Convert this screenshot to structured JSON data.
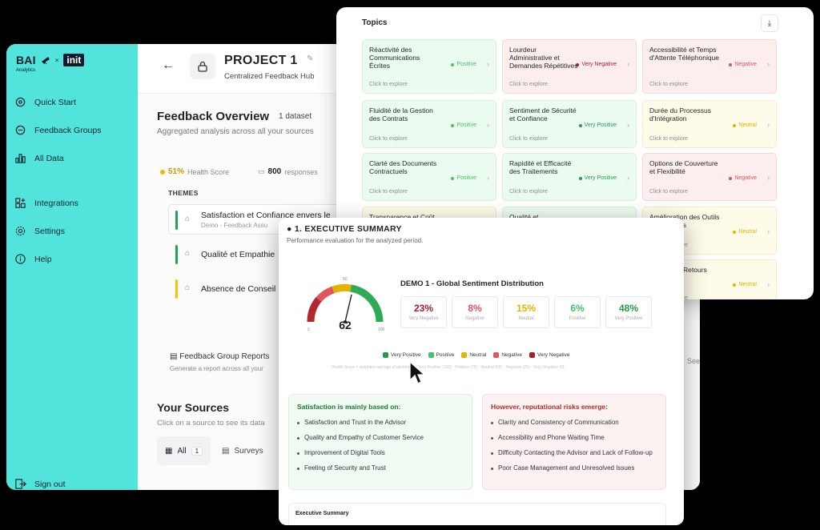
{
  "sidebar": {
    "brand": "BAI",
    "brand_sub": "Analytics",
    "brand_x": "×",
    "partner": "init",
    "items": [
      {
        "label": "Quick Start",
        "icon": "grid-icon"
      },
      {
        "label": "Feedback Groups",
        "icon": "layers-icon"
      },
      {
        "label": "All Data",
        "icon": "bar-chart-icon"
      },
      {
        "label": "Integrations",
        "icon": "integrations-icon"
      },
      {
        "label": "Settings",
        "icon": "gear-icon"
      },
      {
        "label": "Help",
        "icon": "info-icon"
      }
    ],
    "sign_out": "Sign out"
  },
  "header": {
    "project_title": "PROJECT 1",
    "project_subtitle": "Centralized Feedback Hub"
  },
  "overview": {
    "title": "Feedback Overview",
    "dataset_count": "1 dataset",
    "subtitle": "Aggregated analysis across all your sources",
    "health_value": "51%",
    "health_label": "Health Score",
    "responses_value": "800",
    "responses_label": "responses",
    "themes_label": "THEMES",
    "themes": [
      {
        "title": "Satisfaction et Confiance envers le",
        "sub": "Demo - Feedback Assu",
        "color": "#1fa84f"
      },
      {
        "title": "Qualité et Empathie",
        "sub": "",
        "color": "#1fa84f"
      },
      {
        "title": "Absence de Conseil",
        "sub": "",
        "color": "#f2c300"
      }
    ],
    "report_title": "Feedback Group Reports",
    "report_sub": "Generate a report across all your",
    "see_more": "See"
  },
  "sources": {
    "title": "Your Sources",
    "subtitle": "Click on a source to see its data",
    "tab_all": "All",
    "tab_all_count": "1",
    "tab_surveys": "Surveys"
  },
  "topics": {
    "title": "Topics",
    "explore": "Click to explore",
    "items": [
      {
        "name": "Réactivité des Communications Écrites",
        "sentiment": "Positive",
        "kind": "pos"
      },
      {
        "name": "Lourdeur Administrative et Demandes Répétitives",
        "sentiment": "Very Negative",
        "kind": "neg"
      },
      {
        "name": "Accessibilité et Temps d'Attente Téléphonique",
        "sentiment": "Negative",
        "kind": "neg"
      },
      {
        "name": "Fluidité de la Gestion des Contrats",
        "sentiment": "Positive",
        "kind": "pos"
      },
      {
        "name": "Sentiment de Sécurité et Confiance",
        "sentiment": "Very Positive",
        "kind": "pos"
      },
      {
        "name": "Durée du Processus d'Intégration",
        "sentiment": "Neutral",
        "kind": "neu"
      },
      {
        "name": "Clarté des Documents Contractuels",
        "sentiment": "Positive",
        "kind": "pos"
      },
      {
        "name": "Rapidité et Efficacité des Traitements",
        "sentiment": "Very Positive",
        "kind": "pos"
      },
      {
        "name": "Options de Couverture et Flexibilité",
        "sentiment": "Negative",
        "kind": "neg"
      },
      {
        "name": "Transparence et Coût",
        "sentiment": "",
        "kind": "neu"
      },
      {
        "name": "Qualité et",
        "sentiment": "",
        "kind": "pos"
      },
      {
        "name": "Amélioration des Outils Numériques",
        "sentiment": "Neutral",
        "kind": "neu"
      },
      {
        "name": "",
        "sentiment": "",
        "kind": "neu"
      },
      {
        "name": "",
        "sentiment": "",
        "kind": "neu"
      },
      {
        "name": "Délais des Retours",
        "sentiment": "Neutral",
        "kind": "neu"
      }
    ]
  },
  "sentiment_colors": {
    "Very Positive": "#1f9d4a",
    "Positive": "#43c463",
    "Neutral": "#e4b300",
    "Negative": "#e0545c",
    "Very Negative": "#a51f2a"
  },
  "exec": {
    "title": "1. EXECUTIVE SUMMARY",
    "subtitle": "Performance evaluation for the analyzed period.",
    "gauge_value": "62",
    "gauge_min": "0",
    "gauge_mid": "50",
    "gauge_max": "100",
    "dist_title": "DEMO 1 - Global Sentiment Distribution",
    "stats": [
      {
        "value": "23%",
        "label": "Very Negative",
        "color": "#a51f2a"
      },
      {
        "value": "8%",
        "label": "Negative",
        "color": "#e0545c"
      },
      {
        "value": "15%",
        "label": "Neutral",
        "color": "#e4b300"
      },
      {
        "value": "6%",
        "label": "Positive",
        "color": "#43c463"
      },
      {
        "value": "48%",
        "label": "Very Positive",
        "color": "#1f9d4a"
      }
    ],
    "legend": [
      "Very Positive",
      "Positive",
      "Neutral",
      "Negative",
      "Very Negative"
    ],
    "legend_note": "Health Score = weighted average of sentiments: Very Positive (100) · Positive (75) · Neutral (50) · Negative (25) · Very Negative (0)",
    "satisfaction_title": "Satisfaction is mainly based on:",
    "satisfaction_items": [
      "Satisfaction and Trust in the Advisor",
      "Quality and Empathy of Customer Service",
      "Improvement of Digital Tools",
      "Feeling of Security and Trust"
    ],
    "risks_title": "However, reputational risks emerge:",
    "risks_items": [
      "Clarity and Consistency of Communication",
      "Accessibility and Phone Waiting Time",
      "Difficulty Contacting the Advisor and Lack of Follow-up",
      "Poor Case Management and Unresolved Issues"
    ],
    "footer_label": "Executive Summary"
  }
}
